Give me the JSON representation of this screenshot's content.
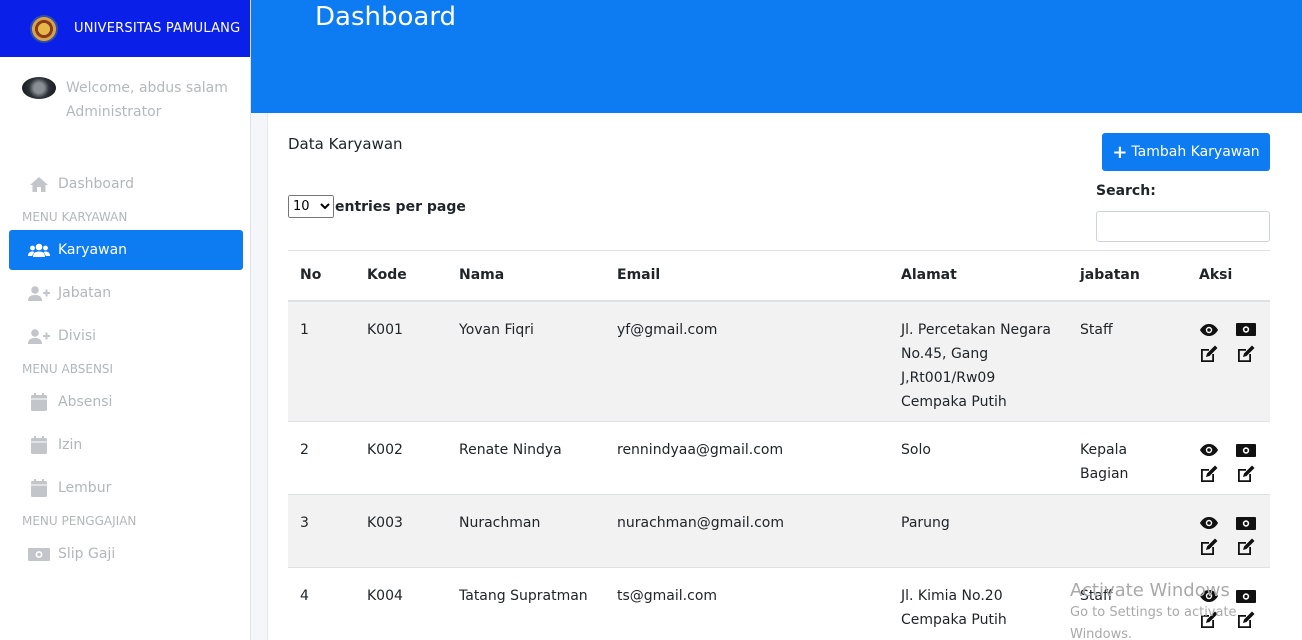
{
  "brand": {
    "name": "UNIVERSITAS PAMULANG"
  },
  "user": {
    "welcome": "Welcome, abdus salam",
    "role": "Administrator"
  },
  "nav": {
    "dashboard": "Dashboard",
    "header_karyawan": "MENU KARYAWAN",
    "karyawan": "Karyawan",
    "jabatan": "Jabatan",
    "divisi": "Divisi",
    "header_absensi": "MENU ABSENSI",
    "absensi": "Absensi",
    "izin": "Izin",
    "lembur": "Lembur",
    "header_penggajian": "MENU PENGGAJIAN",
    "slip_gaji": "Slip Gaji"
  },
  "header": {
    "title": "Dashboard"
  },
  "card": {
    "title": "Data Karyawan",
    "add_button": "Tambah Karyawan",
    "entries_value": "10",
    "entries_label": "entries per page",
    "search_label": "Search:",
    "search_value": ""
  },
  "table": {
    "headers": {
      "no": "No",
      "kode": "Kode",
      "nama": "Nama",
      "email": "Email",
      "alamat": "Alamat",
      "jabatan": "jabatan",
      "aksi": "Aksi"
    },
    "rows": [
      {
        "no": "1",
        "kode": "K001",
        "nama": "Yovan Fiqri",
        "email": "yf@gmail.com",
        "alamat": "Jl. Percetakan Negara No.45, Gang J,Rt001/Rw09 Cempaka Putih",
        "jabatan": "Staff"
      },
      {
        "no": "2",
        "kode": "K002",
        "nama": "Renate Nindya",
        "email": "rennindyaa@gmail.com",
        "alamat": "Solo",
        "jabatan": "Kepala Bagian"
      },
      {
        "no": "3",
        "kode": "K003",
        "nama": "Nurachman",
        "email": "nurachman@gmail.com",
        "alamat": "Parung",
        "jabatan": ""
      },
      {
        "no": "4",
        "kode": "K004",
        "nama": "Tatang Supratman",
        "email": "ts@gmail.com",
        "alamat": "Jl. Kimia No.20 Cempaka Putih",
        "jabatan": "Staff"
      }
    ]
  },
  "watermark": {
    "line1": "Activate Windows",
    "line2": "Go to Settings to activate Windows."
  },
  "colors": {
    "primary": "#0d7bf2",
    "brand_bar": "#0a1fe8",
    "sidebar_text": "#b3b7bb"
  },
  "icons": {
    "view": "eye-icon",
    "money": "money-icon",
    "edit": "edit-icon",
    "user": "users-icon",
    "calendar": "calendar-icon",
    "home": "home-icon"
  }
}
